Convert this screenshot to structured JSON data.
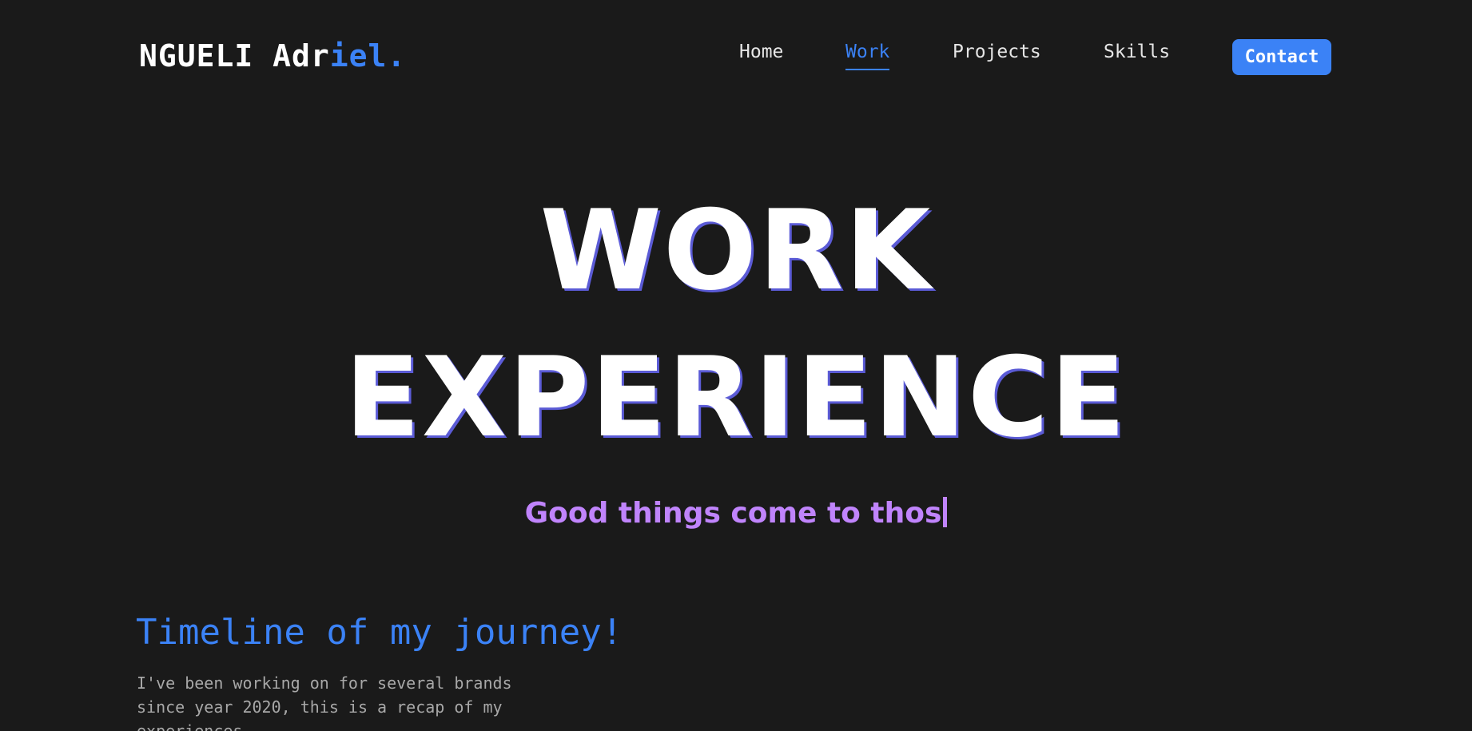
{
  "header": {
    "logo_main": "NGUELI Adr",
    "logo_accent": "iel.",
    "nav": {
      "home": "Home",
      "work": "Work",
      "projects": "Projects",
      "skills": "Skills"
    },
    "contact_label": "Contact",
    "active_tab": "Work"
  },
  "hero": {
    "title_line1": "WORK",
    "title_line2": "EXPERIENCE",
    "tagline": "Good things come to thos"
  },
  "timeline": {
    "title": "Timeline of my journey!",
    "description": "I've been working on for several brands since year 2020, this is a recap of my experiences"
  },
  "colors": {
    "background": "#1a1a1a",
    "accent": "#3b82f6",
    "tagline": "#c084fc"
  }
}
